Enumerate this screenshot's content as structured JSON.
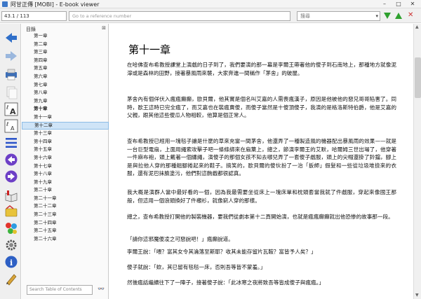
{
  "window": {
    "title": "阿甘正傳 [MOBI] - E-book viewer",
    "minimize": "–",
    "maximize": "□",
    "close": "✕"
  },
  "toolbar": {
    "position_value": "43.1 / 113",
    "reference_placeholder": "Go to a reference number",
    "search_placeholder": "搜尋",
    "search_dropdown": "▾",
    "prev_match": "previous-match-icon",
    "next_match": "next-match-icon",
    "close_symbol": "✕"
  },
  "left_tools": [
    {
      "name": "back-icon"
    },
    {
      "name": "forward-icon"
    },
    {
      "name": "print-icon"
    },
    {
      "name": "copy-icon"
    },
    {
      "name": "font-larger-icon"
    },
    {
      "name": "font-smaller-icon"
    },
    {
      "name": "table-of-contents-icon"
    },
    {
      "name": "previous-page-icon"
    },
    {
      "name": "next-page-icon"
    },
    {
      "name": "open-ebook-icon"
    },
    {
      "name": "bookmark-icon"
    },
    {
      "name": "theme-icon"
    },
    {
      "name": "preferences-icon"
    },
    {
      "name": "info-icon"
    },
    {
      "name": "edit-icon"
    }
  ],
  "toc": {
    "header": "目錄",
    "close_symbol": "⊠",
    "items": [
      "第一章",
      "第二章",
      "第三章",
      "第四章",
      "第五章",
      "第六章",
      "第七章",
      "第八章",
      "第九章",
      "第十章",
      "第十一章",
      "第十二章",
      "第十三章",
      "第十四章",
      "第十五章",
      "第十六章",
      "第十七章",
      "第十八章",
      "第十九章",
      "第二十章",
      "第二十一章",
      "第二十二章",
      "第二十三章",
      "第二十四章",
      "第二十五章",
      "第二十六章"
    ],
    "selected_index": 11,
    "current_index": 9,
    "search_placeholder": "Search Table of Contents",
    "search_button": "👓"
  },
  "content": {
    "chapter_title": "第十一章",
    "paragraphs": [
      "在哈佛查布希教授課堂上演戲的日子到了，我們要演的那一幕是李爾王帶著他的傻子到石南地上，那種地方就像泥濘或是森林的田野，接著暴風雨來襲，大家奔進一間稱作「茅舍」的破屋。",
      "茅舍內有個佯伏入瘋瘋癲癲，歐貝爾，他其實是個名叫艾嘉的人需喪瘋漢子，原因是他被他的惡兄哥哥陷害了。同時，歐王這時已完全瘋了，而艾嘉也在裝瘋賣傻，而傻子當然是十傻頂傻子，我演的是格洛斯特伯爵，他是艾嘉的父親，跟其他這些傻瓜人物相較，他算是個正常人。",
      "查布希教授已經用一塊毯子讓是什麼的草來充當一間茅舍，他還弄了一種製造風的機器配出暴風雨的效果——就是一台巨型電扇，上面用繩索攻擊子吧一條條綁來在扇葉上，總之，節演李爾王的艾默，哈爾姆三世出場了，他穿著一件麻布袍，頭上戴著一個纏繩，演傻子的那個女孩不知去哪兒弄了一套傻子戲服，頭上的尖帽還掛了鈴鐺，腳上是與拉他人穿的那種翹腳捲起來的鞋子。搞笑的，歐貝爾的傻伙扮了一治「扳師」假髮和一些從垃圾堆撿來的衣服，還有泥巴抹臉塗污，他們對這齣戲都很認真。",
      "我大概是演群人當中最好看的一個，因為我最需要坐從床上一塊床單和枕頭套當我就了件戲服，穿起來像國王那般，但這用一個浪頭換好了件襯衫，就像窮人穿的那樣。",
      "總之，查布希教授打開他的製裝機器，要我們從劇本第十二頁開始演，也就是瘋瘋癲癲就出他恐惨的故事那一段。",
      "「請你這邪魔傻凌之可惡說吧！」瘋癲說道。",
      "李爾王說：「喂？富其女令其淪落至斯耶？收其未能存留片瓦鞍？富皆予人矣？」",
      "傻子就說：「欸，其已留有毯毯一床，否則吾等皆不蒙羞。」",
      "然後瘋話繼續往下了一陣子，接著傻子說：「此冰寒之夜將致吾等皆成傻子與瘋瘋。」"
    ]
  }
}
